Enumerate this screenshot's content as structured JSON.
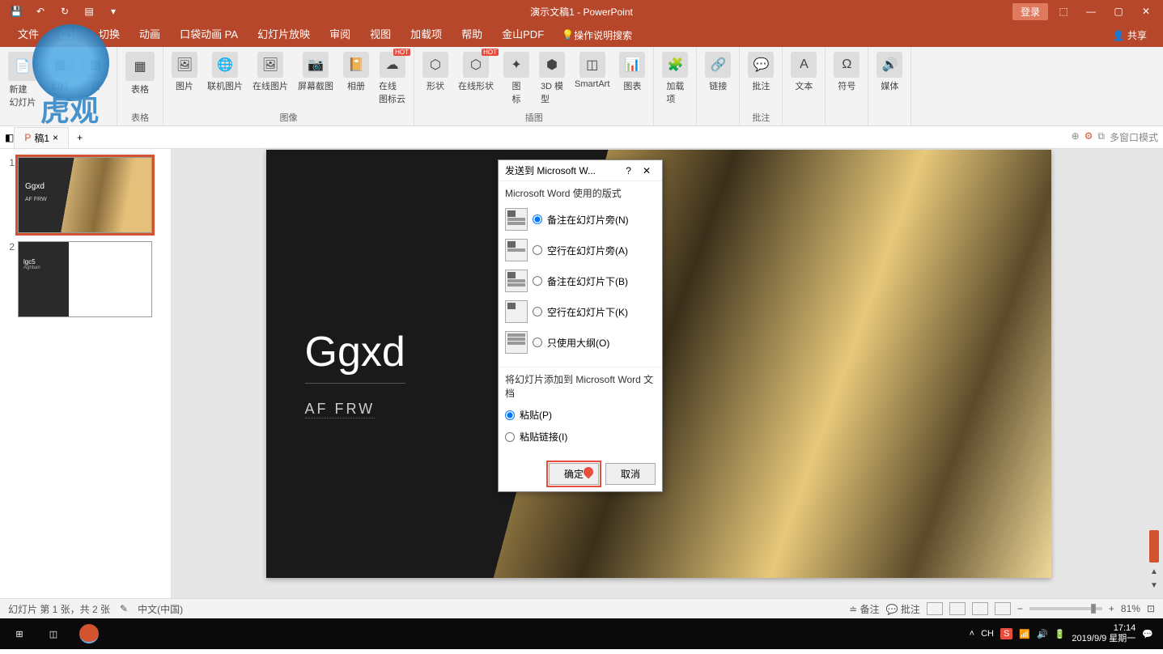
{
  "app": {
    "title": "演示文稿1 - PowerPoint",
    "login": "登录",
    "share": "共享"
  },
  "tabs": {
    "file": "文件",
    "design": "设计",
    "transitions": "切换",
    "animations": "动画",
    "pocket": "口袋动画 PA",
    "slideshow": "幻灯片放映",
    "review": "审阅",
    "view": "视图",
    "addins": "加载项",
    "help": "帮助",
    "jinshan": "金山PDF",
    "tellme": "操作说明搜索"
  },
  "ribbon": {
    "new_slide": "新建\n幻灯片",
    "slide_from": "幻灯",
    "slide_from2": "页",
    "table": "表格",
    "group_table": "表格",
    "picture": "图片",
    "online_picture": "联机图片",
    "from_file": "在线图片",
    "screenshot": "屏幕截图",
    "album": "相册",
    "online_icons": "在线\n图标云",
    "group_images": "图像",
    "shapes": "形状",
    "online_shapes": "在线形状",
    "icons": "图\n标",
    "model3d": "3D 模\n型",
    "smartart": "SmartArt",
    "chart": "图表",
    "group_illustrations": "插图",
    "addin": "加载\n项",
    "link": "链接",
    "comment": "批注",
    "group_comments": "批注",
    "textbox": "文本",
    "symbols": "符号",
    "media": "媒体"
  },
  "doc_tab": {
    "name": "稿1",
    "multiwindow": "多窗口模式"
  },
  "slide": {
    "title": "Ggxd",
    "subtitle": "AF FRW",
    "thumb2_l1": "lgc5",
    "thumb2_l2": "Aghban"
  },
  "dialog": {
    "title": "发送到 Microsoft W...",
    "section1": "Microsoft Word 使用的版式",
    "opt1": "备注在幻灯片旁(N)",
    "opt2": "空行在幻灯片旁(A)",
    "opt3": "备注在幻灯片下(B)",
    "opt4": "空行在幻灯片下(K)",
    "opt5": "只使用大纲(O)",
    "section2": "将幻灯片添加到 Microsoft Word 文档",
    "opt6": "粘贴(P)",
    "opt7": "粘贴链接(I)",
    "ok": "确定",
    "cancel": "取消"
  },
  "status": {
    "slide_info": "幻灯片 第 1 张，共 2 张",
    "language": "中文(中国)",
    "notes": "备注",
    "comments": "批注",
    "zoom": "81%"
  },
  "taskbar": {
    "ime": "CH",
    "time": "17:14",
    "date": "2019/9/9 星期一"
  },
  "watermark": "虎观"
}
